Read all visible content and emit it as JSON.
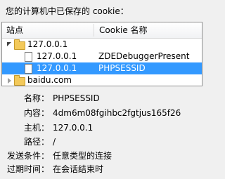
{
  "heading": "您的计算机中已保存的 cookie：",
  "columns": {
    "site": "站点",
    "cookie_name": "Cookie 名称"
  },
  "tree": {
    "host1": "127.0.0.1",
    "cookies": [
      {
        "site": "127.0.0.1",
        "name": "ZDEDebuggerPresent",
        "selected": false
      },
      {
        "site": "127.0.0.1",
        "name": "PHPSESSID",
        "selected": true
      }
    ],
    "host2": "baidu.com"
  },
  "details": {
    "name_label": "名称：",
    "name_value": "PHPSESSID",
    "content_label": "内容：",
    "content_value": "4dm6m08fgihbc2fgtjus165f26",
    "host_label": "主机：",
    "host_value": "127.0.0.1",
    "path_label": "路径：",
    "path_value": "/",
    "send_label": "发送条件：",
    "send_value": "任意类型的连接",
    "expire_label": "过期时间：",
    "expire_value": "在会话结束时"
  }
}
